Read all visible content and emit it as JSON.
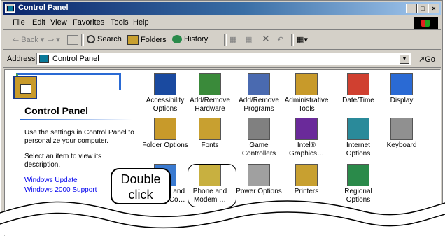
{
  "window": {
    "title": "Control Panel"
  },
  "title_buttons": {
    "minimize": "_",
    "maximize": "□",
    "close": "×"
  },
  "menu": [
    "File",
    "Edit",
    "View",
    "Favorites",
    "Tools",
    "Help"
  ],
  "toolbar": {
    "back": "Back",
    "search": "Search",
    "folders": "Folders",
    "history": "History"
  },
  "address": {
    "label": "Address",
    "value": "Control Panel",
    "go": "Go"
  },
  "left_pane": {
    "heading": "Control Panel",
    "desc1": "Use the settings in Control Panel to personalize your computer.",
    "desc2": "Select an item to view its description.",
    "link1": "Windows Update",
    "link2": "Windows 2000 Support"
  },
  "items": [
    {
      "label": "Accessibility\nOptions",
      "color": "#1a4aa0"
    },
    {
      "label": "Add/Remove\nHardware",
      "color": "#3a8a3a"
    },
    {
      "label": "Add/Remove\nPrograms",
      "color": "#4a6ab0"
    },
    {
      "label": "Administrative\nTools",
      "color": "#c89a2a"
    },
    {
      "label": "Date/Time",
      "color": "#d04030"
    },
    {
      "label": "Display",
      "color": "#2a6ad4"
    },
    {
      "label": "Folder Options",
      "color": "#c89a2a"
    },
    {
      "label": "Fonts",
      "color": "#c8a030"
    },
    {
      "label": "Game\nControllers",
      "color": "#808080"
    },
    {
      "label": "Intel®\nGraphics…",
      "color": "#6a2a9a"
    },
    {
      "label": "Internet\nOptions",
      "color": "#2a8a9a"
    },
    {
      "label": "Keyboard",
      "color": "#909090"
    },
    {
      "label": "Network and\nDial-up Co…",
      "color": "#3a7ad0"
    },
    {
      "label": "Phone and\nModem …",
      "color": "#c8b040"
    },
    {
      "label": "Power Options",
      "color": "#a0a0a0"
    },
    {
      "label": "Printers",
      "color": "#c8a030"
    },
    {
      "label": "Regional\nOptions",
      "color": "#2a8a4a"
    }
  ],
  "callout": {
    "line1": "Double",
    "line2": "click"
  }
}
